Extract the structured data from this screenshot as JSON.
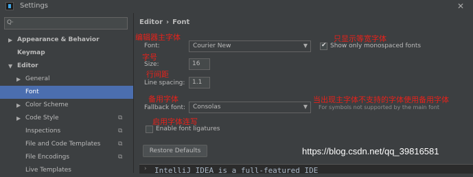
{
  "window": {
    "title": "Settings",
    "close_glyph": "✕"
  },
  "sidebar": {
    "search": {
      "placeholder": "",
      "value": "",
      "icon": "search-icon",
      "icon_glyph": "Q·"
    },
    "items": [
      {
        "label": "Appearance & Behavior",
        "arrow": "▶",
        "bold": true
      },
      {
        "label": "Keymap",
        "arrow": "",
        "bold": true
      },
      {
        "label": "Editor",
        "arrow": "▼",
        "bold": true
      },
      {
        "label": "General",
        "arrow": "▶"
      },
      {
        "label": "Font",
        "arrow": "",
        "selected": true
      },
      {
        "label": "Color Scheme",
        "arrow": "▶"
      },
      {
        "label": "Code Style",
        "arrow": "▶",
        "copy_icon": true
      },
      {
        "label": "Inspections",
        "arrow": "",
        "copy_icon": true
      },
      {
        "label": "File and Code Templates",
        "arrow": "",
        "copy_icon": true
      },
      {
        "label": "File Encodings",
        "arrow": "",
        "copy_icon": true
      },
      {
        "label": "Live Templates",
        "arrow": ""
      }
    ],
    "copy_glyph": "⧉"
  },
  "breadcrumb": {
    "parent": "Editor",
    "separator": "›",
    "current": "Font"
  },
  "form": {
    "font": {
      "label": "Font:",
      "value": "Courier New"
    },
    "monospaced": {
      "label": "Show only monospaced fonts",
      "checked": true
    },
    "size": {
      "label": "Size:",
      "value": "16"
    },
    "line_spacing": {
      "label": "Line spacing:",
      "value": "1.1"
    },
    "fallback": {
      "label": "Fallback font:",
      "value": "Consolas",
      "hint": "For symbols not supported by the main font"
    },
    "ligatures": {
      "label": "Enable font ligatures",
      "checked": false
    },
    "restore_button": "Restore Defaults",
    "dropdown_glyph": "▼"
  },
  "preview": {
    "text": "IntelliJ IDEA is a full-featured IDE",
    "arrow": "›"
  },
  "annotations": {
    "main_font": "编辑器主字体",
    "monospaced_only": "只显示等宽字体",
    "font_size": "字号",
    "line_spacing": "行间距",
    "fallback_font": "备用字体",
    "fallback_explain": "当出现主字体不支持的字体使用备用字体",
    "ligatures": "启用字体连写",
    "color": "#e8221b"
  },
  "watermark": "https://blog.csdn.net/qq_39816581"
}
